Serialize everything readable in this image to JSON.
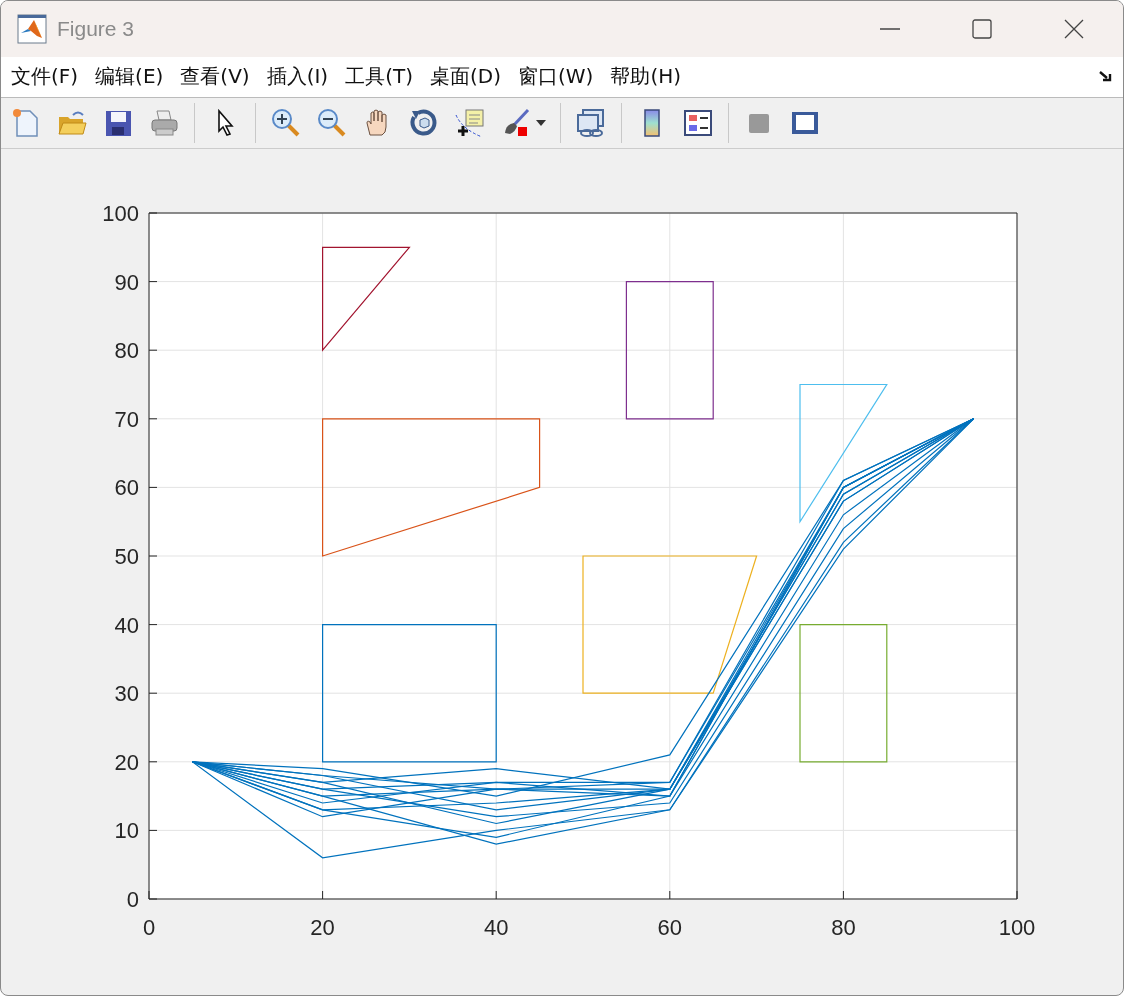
{
  "window": {
    "title": "Figure 3"
  },
  "menu": [
    {
      "label": "文件(F)"
    },
    {
      "label": "编辑(E)"
    },
    {
      "label": "查看(V)"
    },
    {
      "label": "插入(I)"
    },
    {
      "label": "工具(T)"
    },
    {
      "label": "桌面(D)"
    },
    {
      "label": "窗口(W)"
    },
    {
      "label": "帮助(H)"
    }
  ],
  "figure": {
    "chart_data": {
      "type": "line",
      "grid": true,
      "x": [
        5,
        20,
        40,
        60,
        80,
        95
      ],
      "xlim": [
        0,
        100
      ],
      "ylim": [
        0,
        100
      ],
      "xticks": [
        0,
        20,
        40,
        60,
        80,
        100
      ],
      "yticks": [
        0,
        10,
        20,
        30,
        40,
        50,
        60,
        70,
        80,
        90,
        100
      ],
      "series": [
        {
          "color": "#0072bd",
          "values": [
            20,
            6,
            10,
            13,
            51,
            70
          ]
        },
        {
          "color": "#0072bd",
          "values": [
            20,
            12,
            16,
            16,
            58,
            70
          ]
        },
        {
          "color": "#0072bd",
          "values": [
            20,
            13,
            9,
            15,
            60,
            70
          ]
        },
        {
          "color": "#0072bd",
          "values": [
            20,
            15,
            8,
            13,
            52,
            70
          ]
        },
        {
          "color": "#0072bd",
          "values": [
            20,
            17,
            19,
            16,
            59,
            70
          ]
        },
        {
          "color": "#0072bd",
          "values": [
            20,
            18,
            16,
            17,
            60,
            70
          ]
        },
        {
          "color": "#0072bd",
          "values": [
            20,
            16,
            12,
            14,
            54,
            70
          ]
        },
        {
          "color": "#0072bd",
          "values": [
            20,
            14,
            17,
            15,
            56,
            70
          ]
        },
        {
          "color": "#0072bd",
          "values": [
            20,
            19,
            15,
            21,
            61,
            70
          ]
        },
        {
          "color": "#0072bd",
          "values": [
            20,
            17,
            11,
            16,
            59,
            70
          ]
        },
        {
          "color": "#0072bd",
          "values": [
            20,
            13,
            14,
            16,
            60,
            70
          ]
        },
        {
          "color": "#0072bd",
          "values": [
            20,
            16,
            17,
            17,
            61,
            70
          ]
        },
        {
          "color": "#0072bd",
          "values": [
            20,
            18,
            13,
            16,
            58,
            70
          ]
        },
        {
          "color": "#0072bd",
          "values": [
            20,
            15,
            16,
            15,
            60,
            70
          ]
        }
      ]
    }
  }
}
